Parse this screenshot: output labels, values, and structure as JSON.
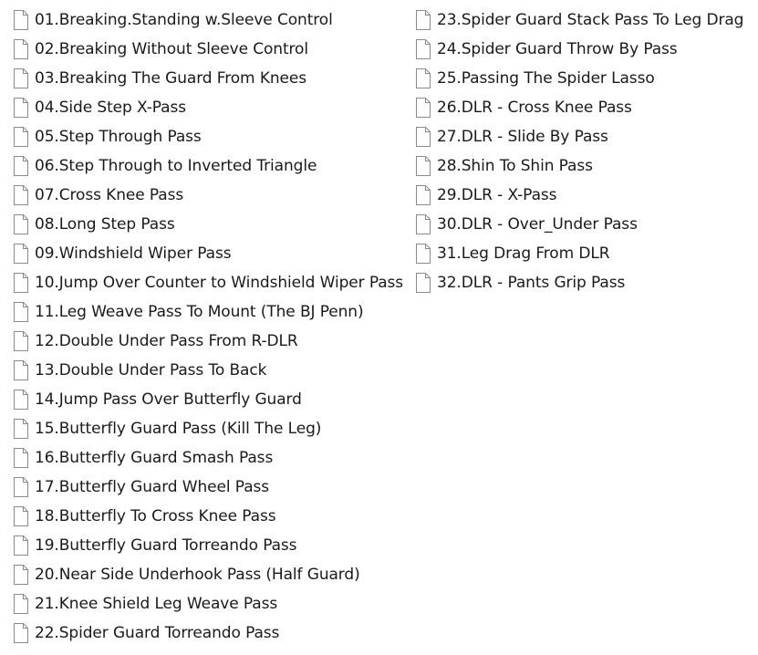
{
  "files": {
    "left": [
      {
        "name": "01.Breaking.Standing w.Sleeve Control",
        "icon": "document-icon"
      },
      {
        "name": "02.Breaking Without Sleeve Control",
        "icon": "document-icon"
      },
      {
        "name": "03.Breaking The Guard From Knees",
        "icon": "document-icon"
      },
      {
        "name": "04.Side Step X-Pass",
        "icon": "document-icon"
      },
      {
        "name": "05.Step Through Pass",
        "icon": "document-icon"
      },
      {
        "name": "06.Step Through to Inverted Triangle",
        "icon": "document-icon"
      },
      {
        "name": "07.Cross Knee Pass",
        "icon": "document-icon"
      },
      {
        "name": "08.Long Step Pass",
        "icon": "document-icon"
      },
      {
        "name": "09.Windshield Wiper Pass",
        "icon": "document-icon"
      },
      {
        "name": "10.Jump Over Counter to Windshield Wiper Pass",
        "icon": "document-icon"
      },
      {
        "name": "11.Leg Weave Pass To Mount (The BJ Penn)",
        "icon": "document-icon"
      },
      {
        "name": "12.Double Under Pass From R-DLR",
        "icon": "document-icon"
      },
      {
        "name": "13.Double Under Pass To Back",
        "icon": "document-icon"
      },
      {
        "name": "14.Jump Pass Over Butterfly Guard",
        "icon": "document-icon"
      },
      {
        "name": "15.Butterfly Guard Pass (Kill The Leg)",
        "icon": "document-icon"
      },
      {
        "name": "16.Butterfly Guard Smash Pass",
        "icon": "document-icon"
      },
      {
        "name": "17.Butterfly Guard Wheel Pass",
        "icon": "document-icon"
      },
      {
        "name": "18.Butterfly To Cross Knee Pass",
        "icon": "document-icon"
      },
      {
        "name": "19.Butterfly Guard Torreando Pass",
        "icon": "document-icon"
      },
      {
        "name": "20.Near Side Underhook Pass (Half Guard)",
        "icon": "document-icon"
      },
      {
        "name": "21.Knee Shield Leg Weave Pass",
        "icon": "document-icon"
      },
      {
        "name": "22.Spider Guard Torreando Pass",
        "icon": "document-icon"
      }
    ],
    "right": [
      {
        "name": "23.Spider Guard Stack Pass To Leg Drag",
        "icon": "document-icon"
      },
      {
        "name": "24.Spider Guard Throw By Pass",
        "icon": "document-icon"
      },
      {
        "name": "25.Passing The Spider Lasso",
        "icon": "document-icon"
      },
      {
        "name": "26.DLR - Cross Knee Pass",
        "icon": "document-icon"
      },
      {
        "name": "27.DLR - Slide By Pass",
        "icon": "document-icon"
      },
      {
        "name": "28.Shin To Shin Pass",
        "icon": "document-icon"
      },
      {
        "name": "29.DLR - X-Pass",
        "icon": "document-icon"
      },
      {
        "name": "30.DLR - Over_Under Pass",
        "icon": "document-icon"
      },
      {
        "name": "31.Leg Drag From DLR",
        "icon": "document-icon"
      },
      {
        "name": "32.DLR - Pants Grip Pass",
        "icon": "document-icon"
      }
    ]
  }
}
